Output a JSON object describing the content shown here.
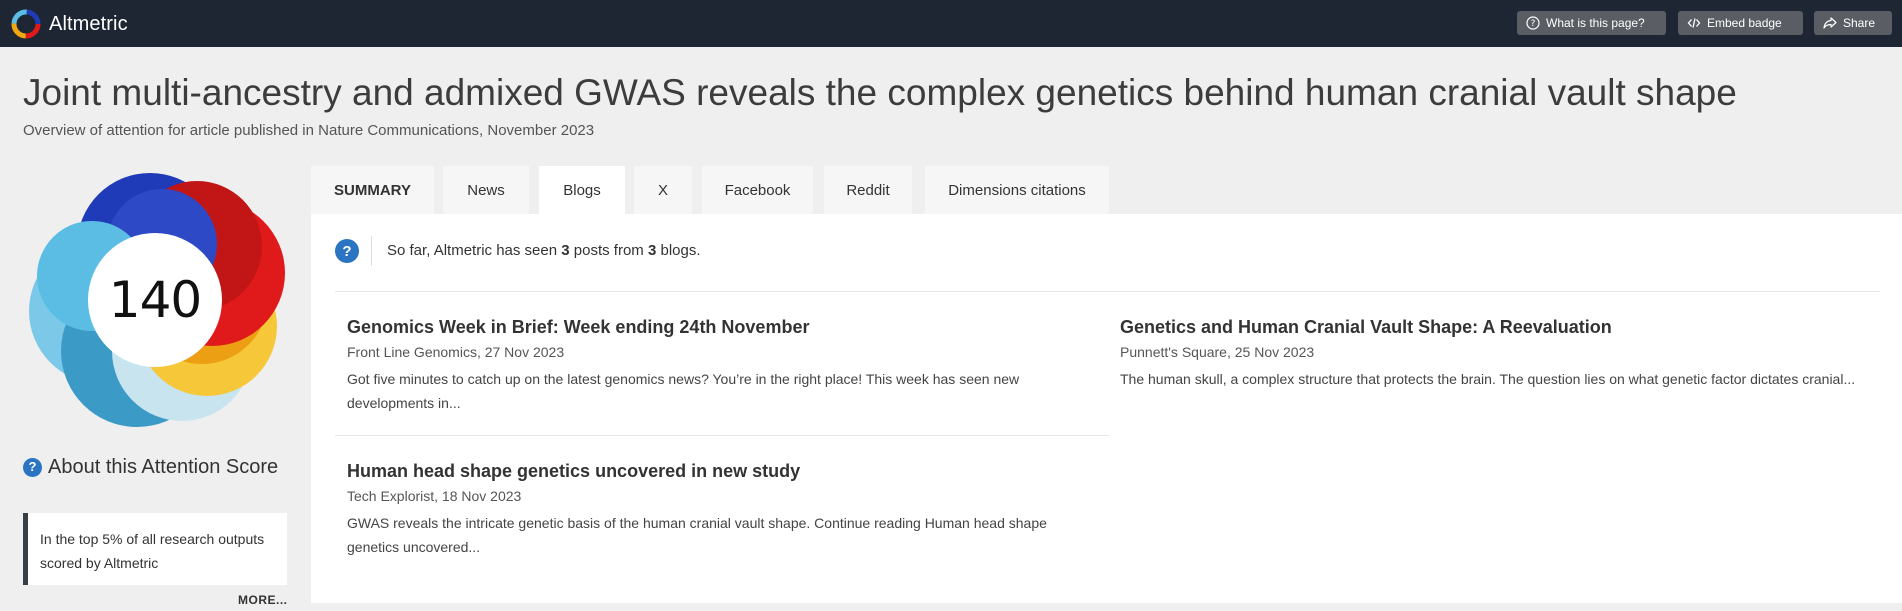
{
  "header": {
    "brand": "Altmetric",
    "buttons": [
      {
        "label": "What is this page?",
        "icon": "question-circle-icon"
      },
      {
        "label": "Embed badge",
        "icon": "code-icon"
      },
      {
        "label": "Share",
        "icon": "share-icon"
      }
    ]
  },
  "article": {
    "title": "Joint multi-ancestry and admixed GWAS reveals the complex genetics behind human cranial vault shape",
    "subtitle": "Overview of attention for article published in Nature Communications, November 2023"
  },
  "score": {
    "value": "140",
    "about_title": "About this Attention Score",
    "about_text": "In the top 5% of all research outputs scored by Altmetric",
    "more_label": "MORE..."
  },
  "tabs": [
    {
      "label": "SUMMARY"
    },
    {
      "label": "News"
    },
    {
      "label": "Blogs",
      "active": true
    },
    {
      "label": "X"
    },
    {
      "label": "Facebook"
    },
    {
      "label": "Reddit"
    },
    {
      "label": "Dimensions citations"
    }
  ],
  "blogs": {
    "intro_prefix": "So far, Altmetric has seen ",
    "post_count": "3",
    "intro_mid": " posts from ",
    "blog_count": "3",
    "intro_suffix": " blogs.",
    "posts": [
      {
        "title": "Genomics Week in Brief: Week ending 24th November",
        "source": "Front Line Genomics, 27 Nov 2023",
        "excerpt": "Got five minutes to catch up on the latest genomics news? You’re in the right place! This week has seen new developments in..."
      },
      {
        "title": "Genetics and Human Cranial Vault Shape: A Reevaluation",
        "source": "Punnett's Square, 25 Nov 2023",
        "excerpt": "The human skull, a complex structure that protects the brain. The question lies on what genetic factor dictates cranial..."
      },
      {
        "title": "Human head shape genetics uncovered in new study",
        "source": "Tech Explorist, 18 Nov 2023",
        "excerpt": "GWAS reveals the intricate genetic basis of the human cranial vault shape. Continue reading Human head shape genetics uncovered..."
      }
    ]
  },
  "colors": {
    "topbar": "#1d2632",
    "accent_blue": "#2b74c2",
    "donut_news": "#e01a1a",
    "donut_blogs": "#f2a60f",
    "donut_x": "#5bbde4",
    "donut_facebook": "#1f3bb8",
    "donut_other": "#c7e4ef"
  }
}
